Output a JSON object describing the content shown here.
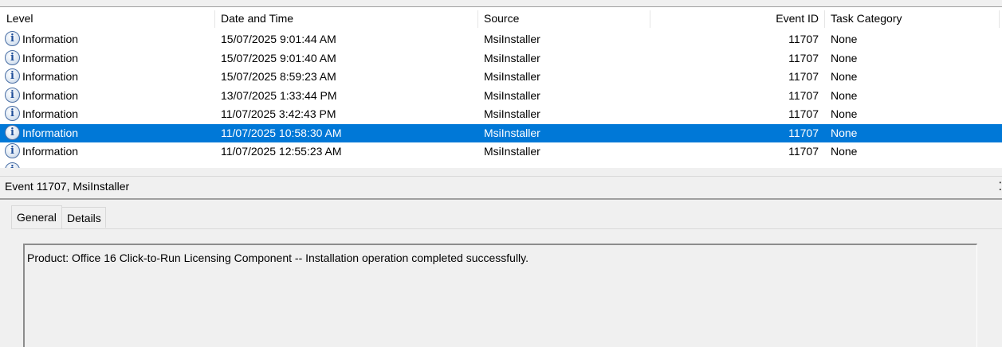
{
  "columns": {
    "level": "Level",
    "datetime": "Date and Time",
    "source": "Source",
    "event_id": "Event ID",
    "task_category": "Task Category"
  },
  "rows": [
    {
      "level": "Information",
      "datetime": "15/07/2025 9:01:44 AM",
      "source": "MsiInstaller",
      "event_id": "11707",
      "task_category": "None",
      "selected": false
    },
    {
      "level": "Information",
      "datetime": "15/07/2025 9:01:40 AM",
      "source": "MsiInstaller",
      "event_id": "11707",
      "task_category": "None",
      "selected": false
    },
    {
      "level": "Information",
      "datetime": "15/07/2025 8:59:23 AM",
      "source": "MsiInstaller",
      "event_id": "11707",
      "task_category": "None",
      "selected": false
    },
    {
      "level": "Information",
      "datetime": "13/07/2025 1:33:44 PM",
      "source": "MsiInstaller",
      "event_id": "11707",
      "task_category": "None",
      "selected": false
    },
    {
      "level": "Information",
      "datetime": "11/07/2025 3:42:43 PM",
      "source": "MsiInstaller",
      "event_id": "11707",
      "task_category": "None",
      "selected": false
    },
    {
      "level": "Information",
      "datetime": "11/07/2025 10:58:30 AM",
      "source": "MsiInstaller",
      "event_id": "11707",
      "task_category": "None",
      "selected": true
    },
    {
      "level": "Information",
      "datetime": "11/07/2025 12:55:23 AM",
      "source": "MsiInstaller",
      "event_id": "11707",
      "task_category": "None",
      "selected": false
    }
  ],
  "detail": {
    "title": "Event 11707, MsiInstaller",
    "tabs": [
      "General",
      "Details"
    ],
    "active_tab": "General",
    "message": "Product: Office 16 Click-to-Run Licensing Component -- Installation operation completed successfully."
  },
  "colors": {
    "selection": "#0078d7",
    "info_icon": "#1f4e99"
  },
  "icons": {
    "level_icon": "information-icon"
  }
}
